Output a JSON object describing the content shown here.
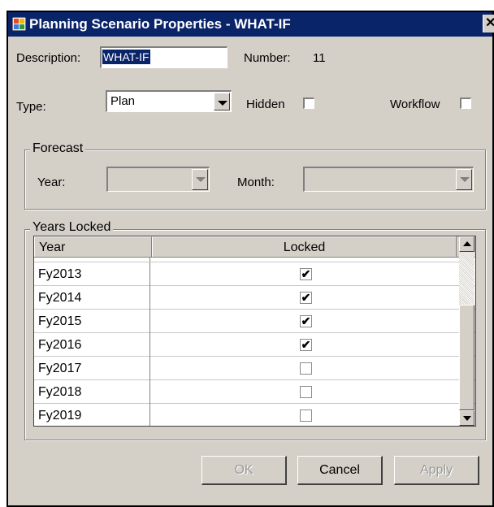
{
  "window": {
    "title": "Planning Scenario Properties - WHAT-IF",
    "close_glyph": "✕"
  },
  "form": {
    "description_label": "Description:",
    "description_value": "WHAT-IF",
    "description_value_visible": "WHAT-IF",
    "number_label": "Number:",
    "number_value": "11",
    "type_label": "Type:",
    "type_value": "Plan",
    "hidden_label": "Hidden",
    "hidden_checked": false,
    "workflow_label": "Workflow",
    "workflow_checked": false
  },
  "forecast": {
    "legend": "Forecast",
    "year_label": "Year:",
    "year_value": "",
    "month_label": "Month:",
    "month_value": ""
  },
  "years_locked": {
    "legend": "Years Locked",
    "columns": [
      "Year",
      "Locked"
    ],
    "rows": [
      {
        "year": "Fy2013",
        "locked": true
      },
      {
        "year": "Fy2014",
        "locked": true
      },
      {
        "year": "Fy2015",
        "locked": true
      },
      {
        "year": "Fy2016",
        "locked": true
      },
      {
        "year": "Fy2017",
        "locked": false
      },
      {
        "year": "Fy2018",
        "locked": false
      },
      {
        "year": "Fy2019",
        "locked": false
      }
    ]
  },
  "buttons": {
    "ok": "OK",
    "cancel": "Cancel",
    "apply": "Apply"
  },
  "icons": {
    "title": "app-icon",
    "check": "✔"
  },
  "colors": {
    "titlebar": "#0a246a",
    "dialog_bg": "#d4d0c8"
  }
}
